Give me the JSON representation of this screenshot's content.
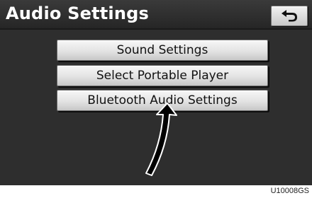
{
  "header": {
    "title": "Audio Settings",
    "back_icon": "return-arrow-icon"
  },
  "menu": {
    "items": [
      {
        "label": "Sound Settings"
      },
      {
        "label": "Select Portable Player"
      },
      {
        "label": "Bluetooth Audio Settings"
      }
    ]
  },
  "annotation": {
    "pointer_icon": "pointer-arrow-icon"
  },
  "figure_code": "U10008GS",
  "colors": {
    "screen_bg": "#2e2e2e",
    "button_face": "#e3e3e3",
    "title_text": "#ffffff"
  }
}
